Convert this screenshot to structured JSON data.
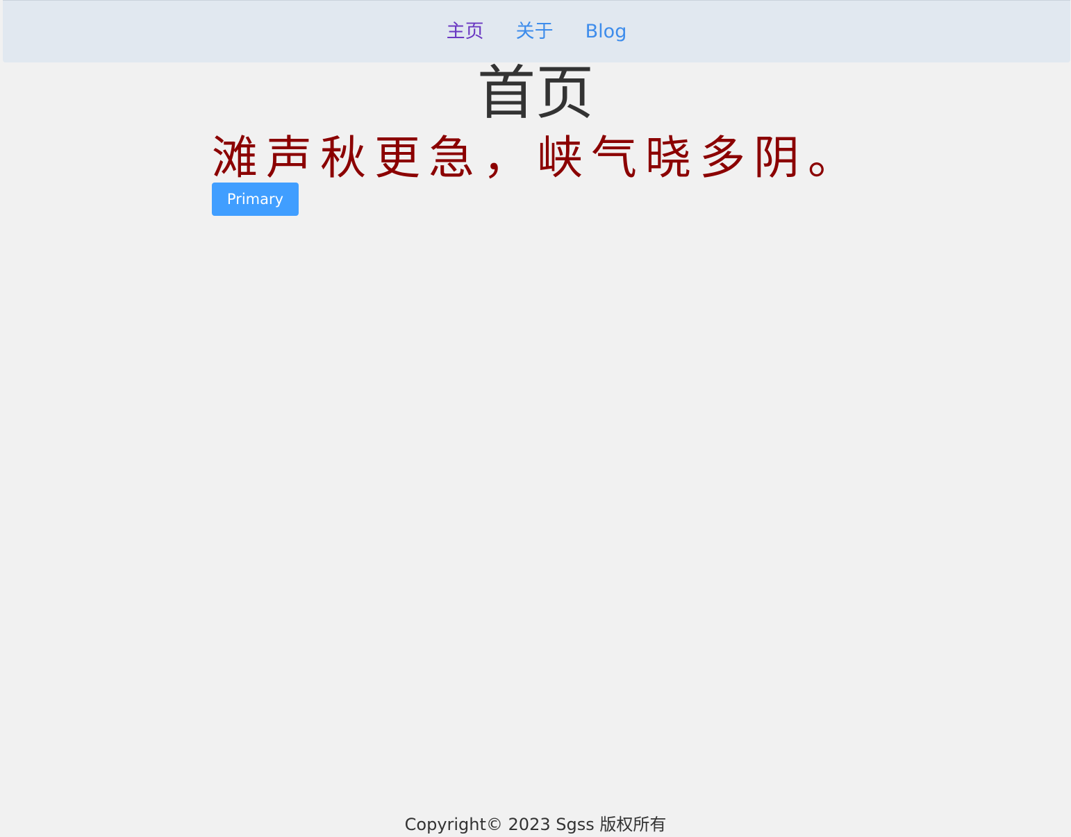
{
  "nav": {
    "items": [
      {
        "label": "主页",
        "state": "visited"
      },
      {
        "label": "关于",
        "state": "default"
      },
      {
        "label": "Blog",
        "state": "default"
      }
    ]
  },
  "main": {
    "title": "首页",
    "poem": "滩声秋更急，峡气晓多阴。",
    "primary_button_label": "Primary"
  },
  "footer": {
    "copyright": "Copyright© 2023 Sgss 版权所有"
  },
  "colors": {
    "background": "#f1f1f1",
    "navbar_background": "#e1e8f0",
    "link": "#3d8ceb",
    "link_visited": "#6a38c2",
    "poem_text": "#8b0000",
    "primary_button": "#409eff",
    "text": "#333333"
  }
}
